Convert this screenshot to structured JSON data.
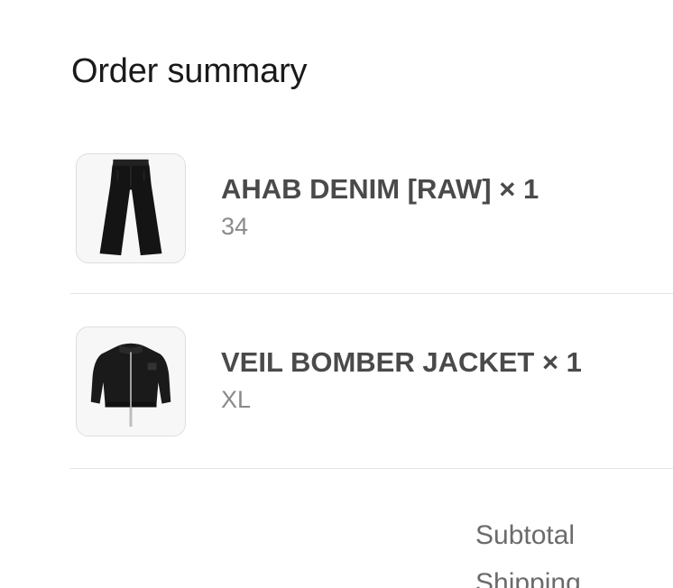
{
  "order_summary": {
    "title": "Order summary",
    "items": [
      {
        "name": "AHAB DENIM [RAW] × 1",
        "variant": "34",
        "image_icon": "black-jeans-icon"
      },
      {
        "name": "VEIL BOMBER JACKET × 1",
        "variant": "XL",
        "image_icon": "black-bomber-jacket-icon"
      }
    ],
    "totals": {
      "subtotal_label": "Subtotal",
      "shipping_label": "Shipping"
    }
  }
}
